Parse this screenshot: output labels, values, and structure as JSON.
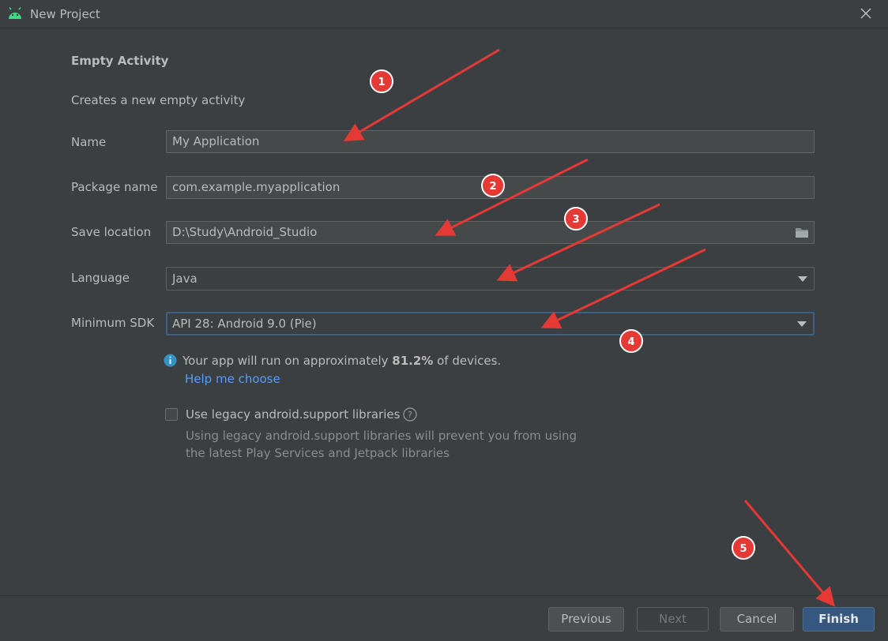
{
  "window": {
    "title": "New Project"
  },
  "form": {
    "heading": "Empty Activity",
    "subtitle": "Creates a new empty activity",
    "name_label": "Name",
    "name_value": "My Application",
    "package_label": "Package name",
    "package_value": "com.example.myapplication",
    "save_label": "Save location",
    "save_value": "D:\\Study\\Android_Studio",
    "language_label": "Language",
    "language_value": "Java",
    "sdk_label": "Minimum SDK",
    "sdk_value": "API 28: Android 9.0 (Pie)"
  },
  "info": {
    "text_before": "Your app will run on approximately ",
    "percent": "81.2%",
    "text_after": " of devices.",
    "help_link": "Help me choose"
  },
  "legacy": {
    "checkbox_label": "Use legacy android.support libraries",
    "checked": false,
    "hint_line1": "Using legacy android.support libraries will prevent you from using",
    "hint_line2": "the latest Play Services and Jetpack libraries"
  },
  "buttons": {
    "previous": "Previous",
    "next": "Next",
    "cancel": "Cancel",
    "finish": "Finish"
  },
  "annotations": {
    "color": "#e53935",
    "markers": [
      "1",
      "2",
      "3",
      "4",
      "5"
    ]
  },
  "icons": {
    "app": "android-icon",
    "close": "close-icon",
    "folder": "folder-icon",
    "info": "info-icon",
    "help": "question-icon"
  }
}
